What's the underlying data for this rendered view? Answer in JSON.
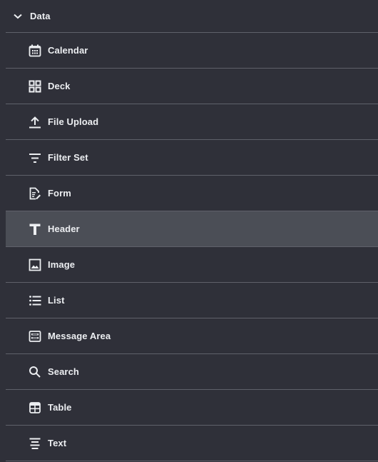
{
  "group": {
    "title": "Data",
    "expanded": true,
    "chevron_icon": "chevron-down-icon"
  },
  "colors": {
    "background": "#2f3039",
    "active_background": "#4b4e56",
    "divider": "#5f616a",
    "text": "#eceef1"
  },
  "items": [
    {
      "label": "Calendar",
      "icon": "calendar-icon",
      "active": false
    },
    {
      "label": "Deck",
      "icon": "grid-icon",
      "active": false
    },
    {
      "label": "File Upload",
      "icon": "upload-icon",
      "active": false
    },
    {
      "label": "Filter Set",
      "icon": "filter-icon",
      "active": false
    },
    {
      "label": "Form",
      "icon": "form-icon",
      "active": false
    },
    {
      "label": "Header",
      "icon": "header-text-icon",
      "active": true
    },
    {
      "label": "Image",
      "icon": "image-icon",
      "active": false
    },
    {
      "label": "List",
      "icon": "list-icon",
      "active": false
    },
    {
      "label": "Message Area",
      "icon": "message-area-icon",
      "active": false
    },
    {
      "label": "Search",
      "icon": "search-icon",
      "active": false
    },
    {
      "label": "Table",
      "icon": "table-icon",
      "active": false
    },
    {
      "label": "Text",
      "icon": "text-align-center-icon",
      "active": false
    }
  ]
}
